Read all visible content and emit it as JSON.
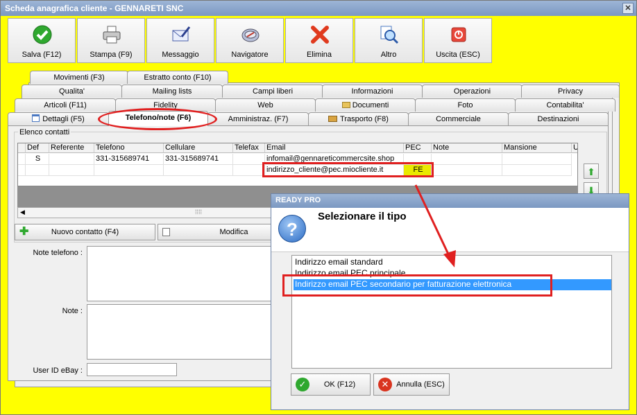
{
  "window": {
    "title": "Scheda anagrafica cliente - GENNARETI SNC",
    "close": "✕"
  },
  "toolbar": [
    {
      "label": "Salva (F12)",
      "icon": "check-icon"
    },
    {
      "label": "Stampa (F9)",
      "icon": "printer-icon"
    },
    {
      "label": "Messaggio",
      "icon": "envelope-pen-icon"
    },
    {
      "label": "Navigatore",
      "icon": "compass-icon"
    },
    {
      "label": "Elimina",
      "icon": "red-x-icon"
    },
    {
      "label": "Altro",
      "icon": "magnifier-icon"
    },
    {
      "label": "Uscita (ESC)",
      "icon": "power-icon"
    }
  ],
  "tabs_row1": [
    "Movimenti (F3)",
    "Estratto conto (F10)"
  ],
  "tabs_row2": [
    "Qualita'",
    "Mailing lists",
    "Campi liberi",
    "Informazioni",
    "Operazioni",
    "Privacy"
  ],
  "tabs_row3": [
    "Articoli (F11)",
    "Fidelity",
    "Web",
    "Documenti",
    "Foto",
    "Contabilita'"
  ],
  "tabs_row4": [
    "Dettagli (F5)",
    "Telefono/note (F6)",
    "Amministraz. (F7)",
    "Trasporto (F8)",
    "Commerciale",
    "Destinazioni"
  ],
  "contacts": {
    "legend": "Elenco contatti",
    "columns": [
      "Def",
      "Referente",
      "Telefono",
      "Cellulare",
      "Telefax",
      "Email",
      "PEC",
      "Note",
      "Mansione",
      "U"
    ],
    "rows": [
      [
        "S",
        "",
        "331-315689741",
        "331-315689741",
        "",
        "infomail@gennareticommercsite.shop",
        "",
        "",
        "",
        ""
      ],
      [
        "",
        "",
        "",
        "",
        "",
        "indirizzo_cliente@pec.miocliente.it",
        "FE",
        "",
        "",
        ""
      ]
    ],
    "scroll_grip": "⁞⁞⁞⁞"
  },
  "buttons": {
    "new_contact": "Nuovo contatto (F4)",
    "edit": "Modifica"
  },
  "form": {
    "phone_notes_label": "Note telefono :",
    "notes_label": "Note :",
    "ebay_label": "User ID eBay :"
  },
  "dialog": {
    "title": "READY PRO",
    "heading": "Selezionare il tipo",
    "question_mark": "?",
    "options": [
      "Indirizzo email standard",
      "Indirizzo email PEC principale",
      "Indirizzo email PEC secondario per fatturazione elettronica"
    ],
    "ok_label": "OK (F12)",
    "cancel_label": "Annulla (ESC)"
  },
  "colors": {
    "background": "#ffff00",
    "highlight": "#e02020",
    "selection": "#3399ff"
  }
}
